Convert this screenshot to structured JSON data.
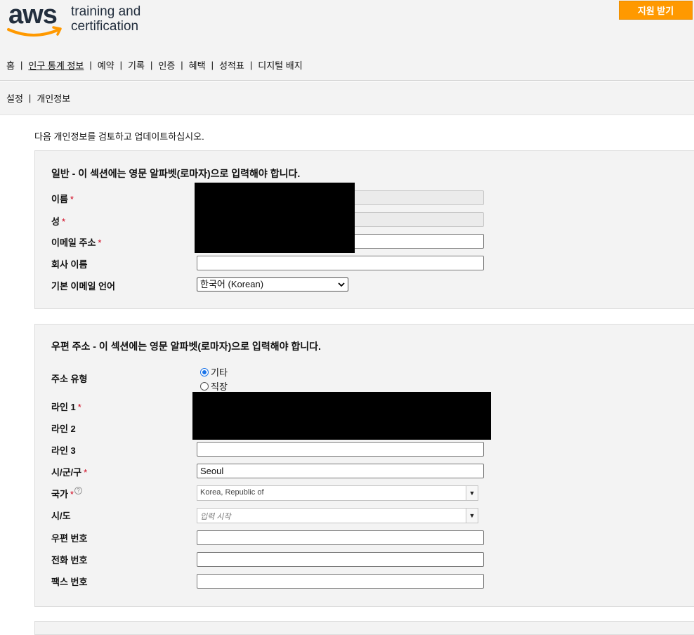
{
  "header": {
    "logo_text": "aws",
    "tagline_line1": "training and",
    "tagline_line2": "certification",
    "support_button": "지원 받기"
  },
  "topnav": [
    "홈",
    "인구 통계 정보",
    "예약",
    "기록",
    "인증",
    "혜택",
    "성적표",
    "디지털 배지"
  ],
  "topnav_separator": "|",
  "subnav": [
    "설정",
    "개인정보"
  ],
  "intro": "다음 개인정보를 검토하고 업데이트하십시오.",
  "general": {
    "title": "일반 - 이 섹션에는 영문 알파벳(로마자)으로 입력해야 합니다.",
    "first_name_label": "이름",
    "last_name_label": "성",
    "email_label": "이메일 주소",
    "company_label": "회사 이름",
    "company_value": "",
    "email_lang_label": "기본 이메일 언어",
    "email_lang_value": "한국어 (Korean)",
    "required_mark": "*"
  },
  "address": {
    "title": "우편 주소 - 이 섹션에는 영문 알파벳(로마자)으로 입력해야 합니다.",
    "type_label": "주소 유형",
    "type_options": [
      "기타",
      "직장"
    ],
    "type_selected": "기타",
    "line1_label": "라인 1",
    "line2_label": "라인 2",
    "line3_label": "라인 3",
    "line3_value": "",
    "city_label": "시/군/구",
    "city_value": "Seoul",
    "country_label": "국가",
    "country_help": "?",
    "country_value": "Korea, Republic of",
    "state_label": "시/도",
    "state_placeholder": "입력 시작",
    "postal_label": "우편 번호",
    "phone_label": "전화 번호",
    "fax_label": "팩스 번호"
  }
}
